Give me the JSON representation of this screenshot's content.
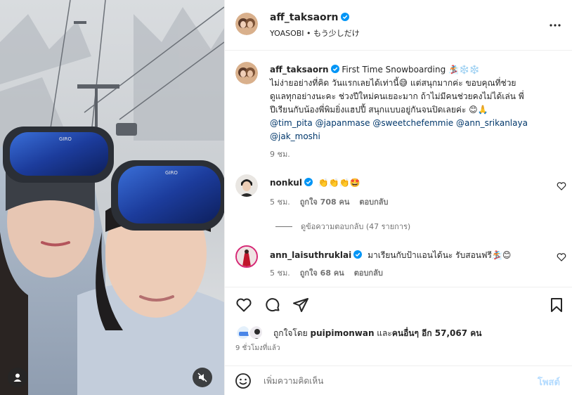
{
  "header": {
    "username": "aff_taksaorn",
    "audio": "YOASOBI • もう少しだけ",
    "more_icon": "more-horizontal-icon"
  },
  "caption": {
    "username": "aff_taksaorn",
    "text_1": " First Time Snowboarding 🏂❄️❄️",
    "text_2": "ไม่ง่ายอย่างที่คิด วันแรกเลยได้เท่านี้😅 แต่สนุกมากค่ะ ขอบคุณที่ช่วย",
    "text_3": "ดูแลทุกอย่างนะคะ ช่วงปีใหม่คนเยอะมาก ถ้าไม่มีคนช่วยคงไม่ได้เล่น พี่",
    "text_4": "ปีเรียนกับน้องพี่พิมยิ่งแฮปปี้ สนุกแบบอยู่กันจนปิดเลยค่ะ 😊🙏",
    "mentions_1": [
      "@tim_pita",
      "@japanmase",
      "@sweetchefemmie",
      "@ann_srikanlaya"
    ],
    "mentions_2": [
      "@jak_moshi"
    ],
    "time": "9 ชม."
  },
  "comments": [
    {
      "username": "nonkul",
      "text": "👏👏👏🤩",
      "time": "5 ชม.",
      "likes": "ถูกใจ 708 คน",
      "reply": "ตอบกลับ",
      "view_replies": "ดูข้อความตอบกลับ (47 รายการ)"
    },
    {
      "username": "ann_laisuthruklai",
      "text": "มาเรียนกับป้าแอนได้นะ รับสอนฟรี🏂😊",
      "time": "5 ชม.",
      "likes": "ถูกใจ 68 คน",
      "reply": "ตอบกลับ"
    }
  ],
  "actions": {
    "icons": [
      "heart-icon",
      "comment-icon",
      "share-icon",
      "bookmark-icon"
    ],
    "liked_by_prefix": "ถูกใจโดย ",
    "liked_by_user": "puipimonwan",
    "liked_by_suffix": " และ",
    "liked_by_others": "คนอื่นๆ อีก 57,067 คน",
    "ago": "9 ชั่วโมงที่แล้ว"
  },
  "comment_bar": {
    "placeholder": "เพิ่มความคิดเห็น",
    "post_label": "โพสต์"
  },
  "colors": {
    "verified": "#0095f6",
    "mention": "#00376b",
    "post_button_disabled": "#b3dbff",
    "secondary_text": "#737373"
  }
}
